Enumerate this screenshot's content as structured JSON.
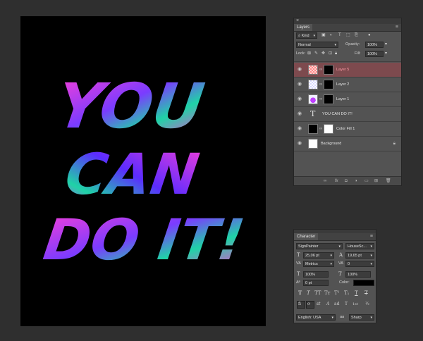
{
  "artwork": {
    "lines": [
      "YOU",
      "CAN",
      "DO IT!"
    ]
  },
  "layers_panel": {
    "tab": "Layers",
    "filter_kind": "Kind",
    "blend_mode": "Normal",
    "opacity_label": "Opacity:",
    "opacity_value": "100%",
    "lock_label": "Lock:",
    "fill_label": "Fill:",
    "fill_value": "100%",
    "layers": [
      {
        "name": "Layer 5",
        "selected": true
      },
      {
        "name": "Layer 2",
        "selected": false
      },
      {
        "name": "Layer 1",
        "selected": false
      },
      {
        "name": "YOU CAN  DO IT!",
        "selected": false
      },
      {
        "name": "Color Fill 1",
        "selected": false
      },
      {
        "name": "Background",
        "selected": false
      }
    ]
  },
  "character_panel": {
    "tab": "Character",
    "font_family": "SignPainter",
    "font_style": "HouseSc...",
    "font_size": "25,06 pt",
    "leading": "19,65 pt",
    "kerning": "Metrics",
    "tracking": "0",
    "vertical_scale": "100%",
    "horizontal_scale": "100%",
    "baseline_shift": "0 pt",
    "color_label": "Color:",
    "language": "English: USA",
    "antialias_icon": "aa",
    "antialias": "Sharp",
    "style_buttons": [
      "T",
      "T",
      "TT",
      "Tт",
      "T¹",
      "T₁",
      "T",
      "T"
    ],
    "opentype_buttons": [
      "fi",
      "ơ",
      "st",
      "A",
      "ad",
      "T",
      "1st",
      "½"
    ]
  },
  "colors": {
    "accent_pink": "#ff3fd6",
    "accent_purple": "#7a3cff",
    "accent_teal": "#1fd3a6",
    "selected_layer": "#7d4a4e"
  }
}
